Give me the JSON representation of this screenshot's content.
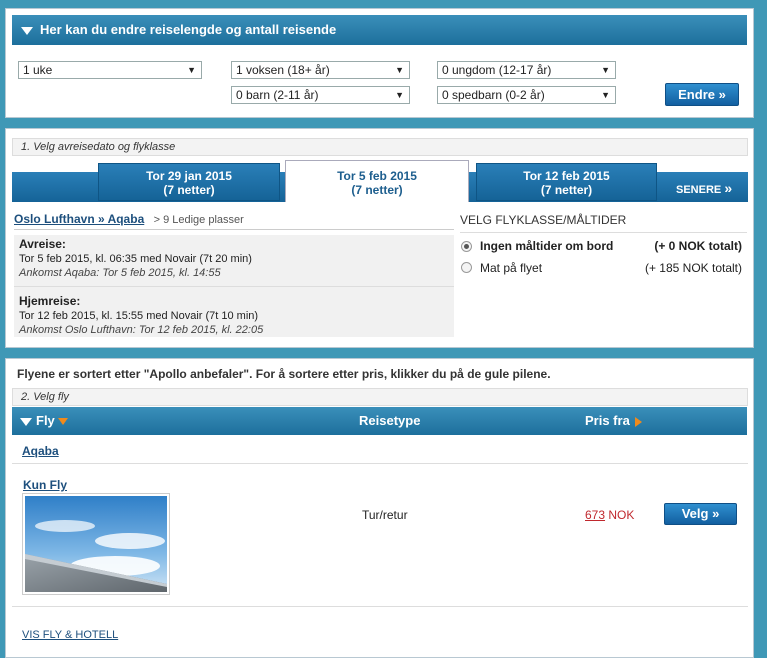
{
  "top_panel": {
    "header": "Her kan du endre reiselengde og antall reisende",
    "duration": "1 uke",
    "adults": "1 voksen (18+ år)",
    "youth": "0 ungdom (12-17 år)",
    "children": "0 barn (2-11 år)",
    "infants": "0 spedbarn (0-2 år)",
    "change_button": "Endre"
  },
  "date_panel": {
    "step_label": "1. Velg avreisedato og flyklasse",
    "tabs": [
      {
        "date": "Tor 29 jan 2015",
        "nights": "(7 netter)"
      },
      {
        "date": "Tor 5 feb 2015",
        "nights": "(7 netter)"
      },
      {
        "date": "Tor 12 feb 2015",
        "nights": "(7 netter)"
      }
    ],
    "later_label": "SENERE",
    "route_link": "Oslo Lufthavn » Aqaba",
    "seats": "> 9 Ledige plasser",
    "departure": {
      "title": "Avreise:",
      "line": "Tor 5 feb 2015, kl. 06:35 med Novair (7t 20 min)",
      "arrival": "Ankomst Aqaba: Tor 5 feb 2015, kl. 14:55"
    },
    "return": {
      "title": "Hjemreise:",
      "line": "Tor 12 feb 2015, kl. 15:55 med Novair (7t 10 min)",
      "arrival": "Ankomst Oslo Lufthavn: Tor 12 feb 2015, kl. 22:05"
    },
    "class_title": "VELG FLYKLASSE/MÅLTIDER",
    "options": [
      {
        "label": "Ingen måltider om bord",
        "price": "(+ 0 NOK totalt)",
        "selected": true
      },
      {
        "label": "Mat på flyet",
        "price": "(+ 185 NOK totalt)",
        "selected": false
      }
    ]
  },
  "flight_panel": {
    "sort_note": "Flyene er sortert etter \"Apollo anbefaler\". For å sortere etter pris, klikker du på de gule pilene.",
    "step_label": "2. Velg fly",
    "col_fly": "Fly",
    "col_type": "Reisetype",
    "col_price": "Pris fra",
    "destination": "Aqaba",
    "product": "Kun Fly",
    "travel_type": "Tur/retur",
    "price": "673",
    "currency": "NOK",
    "select_button": "Velg",
    "hotel_link": "VIS FLY & HOTELL"
  },
  "colors": {
    "accent": "#1d6f9c",
    "price": "#c0282d",
    "sort_arrow": "#f08a1c"
  }
}
